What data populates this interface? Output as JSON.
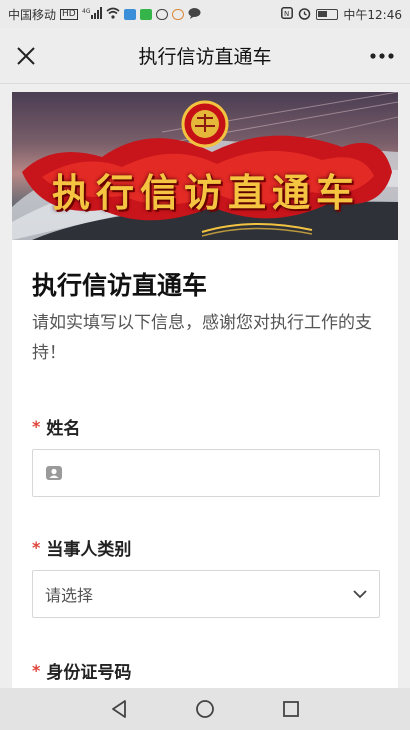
{
  "status_bar": {
    "carrier": "中国移动",
    "network_badge": "HD",
    "network_type": "4G",
    "time": "中午12:46",
    "icons": [
      "hd-icon",
      "signal-icon",
      "wifi-icon",
      "app-notification-icon",
      "nfc-icon",
      "alarm-icon",
      "battery-icon"
    ]
  },
  "header": {
    "title": "执行信访直通车",
    "close_icon": "close-icon",
    "more_icon": "more-icon"
  },
  "banner": {
    "text": "执行信访直通车",
    "emblem": "court-emblem"
  },
  "form": {
    "title": "执行信访直通车",
    "description": "请如实填写以下信息，感谢您对执行工作的支持！",
    "required_mark": "*",
    "fields": [
      {
        "label": "姓名",
        "required": true,
        "type": "text",
        "icon": "person-card-icon",
        "value": ""
      },
      {
        "label": "当事人类别",
        "required": true,
        "type": "select",
        "value": "请选择"
      },
      {
        "label": "身份证号码",
        "required": true,
        "type": "text",
        "value": ""
      }
    ]
  },
  "colors": {
    "required": "#e0453b",
    "banner_text": "#f5c542",
    "background": "#eeeeee"
  }
}
